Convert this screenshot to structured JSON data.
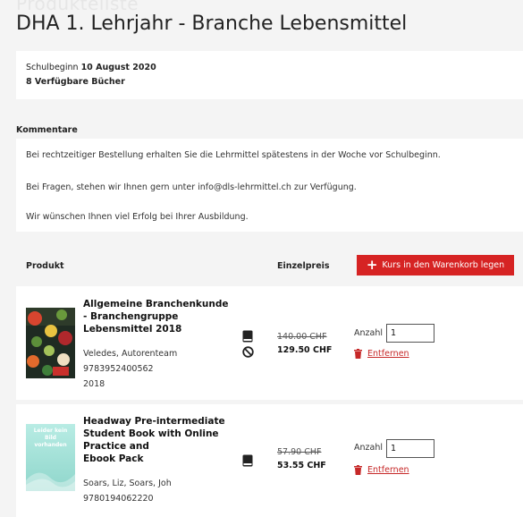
{
  "page": {
    "ghost_text": "Produkteliste",
    "title": "DHA 1. Lehrjahr - Branche Lebensmittel"
  },
  "info": {
    "school_start_label": "Schulbeginn",
    "school_start_date": "10 August 2020",
    "available_books": "8 Verfügbare Bücher"
  },
  "comments": {
    "heading": "Kommentare",
    "lines": [
      "Bei rechtzeitiger Bestellung erhalten Sie die Lehrmittel spätestens in der Woche vor Schulbeginn.",
      "Bei Fragen, stehen wir Ihnen gern unter info@dls-lehrmittel.ch zur Verfügung.",
      "Wir wünschen Ihnen viel Erfolg bei Ihrer Ausbildung."
    ]
  },
  "table": {
    "col_product": "Produkt",
    "col_price": "Einzelpreis",
    "cart_button": "Kurs in den Warenkorb legen"
  },
  "products": [
    {
      "title_lines": [
        "Allgemeine Branchenkunde",
        "- Branchengruppe",
        "Lebensmittel 2018"
      ],
      "authors": "Veledes, Autorenteam",
      "isbn": "9783952400562",
      "year": "2018",
      "old_price": "140.00 CHF",
      "new_price": "129.50 CHF",
      "qty_label": "Anzahl",
      "qty_value": "1",
      "remove_label": "Entfernen"
    },
    {
      "title_lines": [
        "Headway Pre-intermediate",
        "Student Book with Online",
        "Practice and",
        "Ebook Pack"
      ],
      "authors": "Soars, Liz, Soars, Joh",
      "isbn": "9780194062220",
      "cover_placeholder": [
        "Leider kein",
        "Bild",
        "vorhanden"
      ],
      "old_price": "57.90 CHF",
      "new_price": "53.55 CHF",
      "qty_label": "Anzahl",
      "qty_value": "1",
      "remove_label": "Entfernen"
    }
  ],
  "colors": {
    "accent_red": "#d62323",
    "page_bg": "#f4f4f4",
    "placeholder_teal": "#9fdcd4"
  },
  "icons": [
    "plus-icon",
    "book-icon",
    "ban-icon",
    "trash-icon"
  ]
}
